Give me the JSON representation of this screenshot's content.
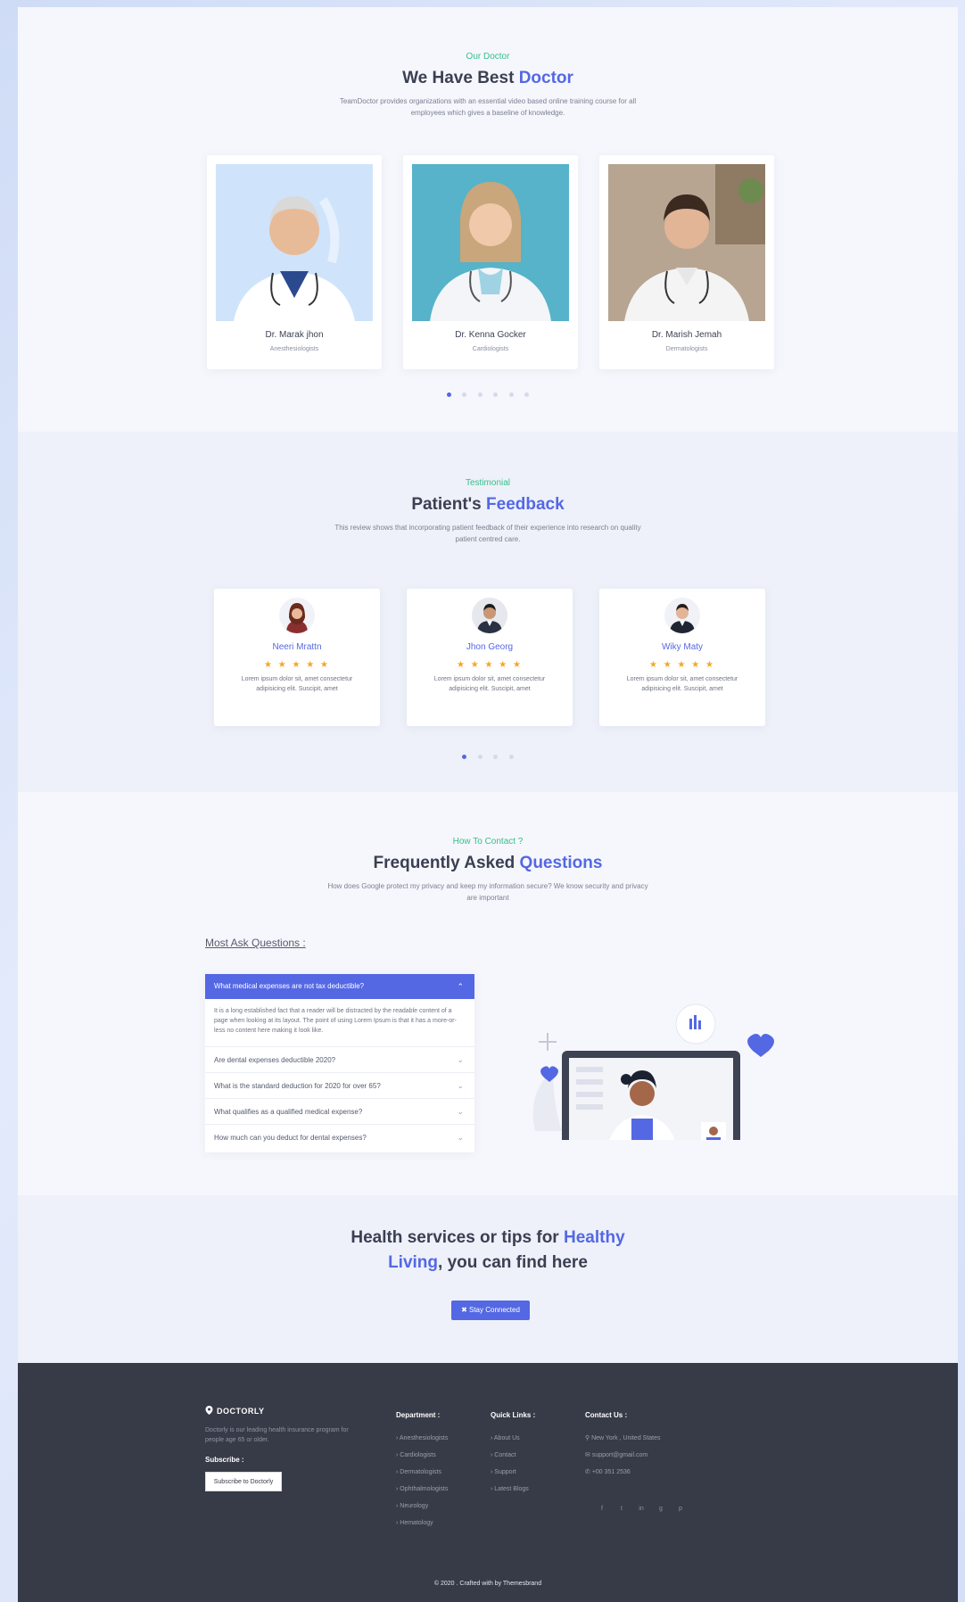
{
  "colors": {
    "accent": "#5468e4",
    "green": "#34c08a",
    "footer_bg": "#373b47",
    "star": "#f5a623"
  },
  "doctors": {
    "eyebrow": "Our Doctor",
    "heading_plain": "We Have Best ",
    "heading_accent": "Doctor",
    "subtitle": "TeamDoctor provides organizations with an essential video based online training course for all employees which gives a baseline of knowledge.",
    "cards": [
      {
        "name": "Dr. Marak jhon",
        "role": "Anesthesiologists"
      },
      {
        "name": "Dr. Kenna Gocker",
        "role": "Cardiologists"
      },
      {
        "name": "Dr. Marish Jemah",
        "role": "Dermatologists"
      }
    ]
  },
  "testimonials": {
    "eyebrow": "Testimonial",
    "heading_plain": "Patient's ",
    "heading_accent": "Feedback",
    "subtitle": "This review shows that incorporating patient feedback of their experience into research on quality patient centred care.",
    "cards": [
      {
        "name": "Neeri Mrattn",
        "stars": "★ ★ ★ ★ ★",
        "text": "Lorem ipsum dolor sit, amet consectetur adipisicing elit. Suscipit, amet"
      },
      {
        "name": "Jhon Georg",
        "stars": "★ ★ ★ ★ ★",
        "text": "Lorem ipsum dolor sit, amet consectetur adipisicing elit. Suscipit, amet"
      },
      {
        "name": "Wiky Maty",
        "stars": "★ ★ ★ ★ ★",
        "text": "Lorem ipsum dolor sit, amet consectetur adipisicing elit. Suscipit, amet"
      }
    ]
  },
  "faq": {
    "eyebrow": "How To Contact ?",
    "heading_plain": "Frequently Asked ",
    "heading_accent": "Questions",
    "subtitle": "How does Google protect my privacy and keep my information secure? We know security and privacy are important",
    "label": "Most Ask Questions :",
    "open_question": "What medical expenses are not tax deductible?",
    "open_answer": "It is a long established fact that a reader will be distracted by the readable content of a page when looking at its layout. The point of using Lorem Ipsum is that it has a more-or-less no content here making it look like.",
    "questions": [
      "Are dental expenses deductible 2020?",
      "What is the standard deduction for 2020 for over 65?",
      "What qualifies as a qualified medical expense?",
      "How much can you deduct for dental expenses?"
    ],
    "chevron_up": "⌃",
    "chevron_down": "⌄"
  },
  "cta": {
    "line1_plain": "Health services or tips for ",
    "line1_accent": "Healthy",
    "line2_accent": "Living",
    "line2_plain": ", you can find here",
    "button": "✖ Stay Connected"
  },
  "footer": {
    "brand": "DOCTORLY",
    "description": "Doctorly is our leading health insurance program for people age 65 or older.",
    "subscribe_label": "Subscribe :",
    "subscribe_button": "Subscribe to Doctorly",
    "department": {
      "title": "Department :",
      "items": [
        "Anesthesiologists",
        "Cardiologists",
        "Dermatologists",
        "Ophthalmologists",
        "Neurology",
        "Hematology"
      ]
    },
    "quick_links": {
      "title": "Quick Links :",
      "items": [
        "About Us",
        "Contact",
        "Support",
        "Latest Blogs"
      ]
    },
    "contact": {
      "title": "Contact Us :",
      "address": "New York , United States",
      "email": "support@gmail.com",
      "phone": "+00 351 2536"
    },
    "social": [
      "f",
      "t",
      "in",
      "g",
      "p"
    ],
    "copyright": "© 2020 . Crafted with by Themesbrand"
  }
}
